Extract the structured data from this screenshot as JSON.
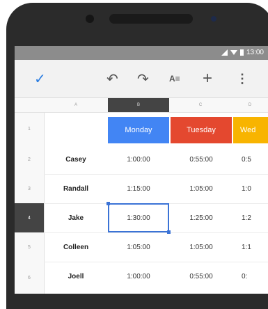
{
  "status": {
    "time": "13:00"
  },
  "toolbar": {
    "check_icon": "check-icon",
    "undo_icon": "undo-icon",
    "redo_icon": "redo-icon",
    "format_label": "A",
    "add_icon": "add-icon",
    "more_icon": "more-vert-icon"
  },
  "sheet": {
    "column_headers": [
      "A",
      "B",
      "C",
      "D"
    ],
    "row_numbers": [
      "1",
      "2",
      "3",
      "4",
      "5",
      "6"
    ],
    "days": [
      "Monday",
      "Tuesday",
      "Wed"
    ],
    "day_colors": [
      "#4285f4",
      "#e4482f",
      "#f8b400"
    ],
    "rows": [
      {
        "name": "Casey",
        "values": [
          "1:00:00",
          "0:55:00",
          "0:5"
        ]
      },
      {
        "name": "Randall",
        "values": [
          "1:15:00",
          "1:05:00",
          "1:0"
        ]
      },
      {
        "name": "Jake",
        "values": [
          "1:30:00",
          "1:25:00",
          "1:2"
        ]
      },
      {
        "name": "Colleen",
        "values": [
          "1:05:00",
          "1:05:00",
          "1:1"
        ]
      },
      {
        "name": "Joell",
        "values": [
          "1:00:00",
          "0:55:00",
          "0:"
        ]
      }
    ],
    "selected": {
      "row": 3,
      "col": "B"
    }
  }
}
